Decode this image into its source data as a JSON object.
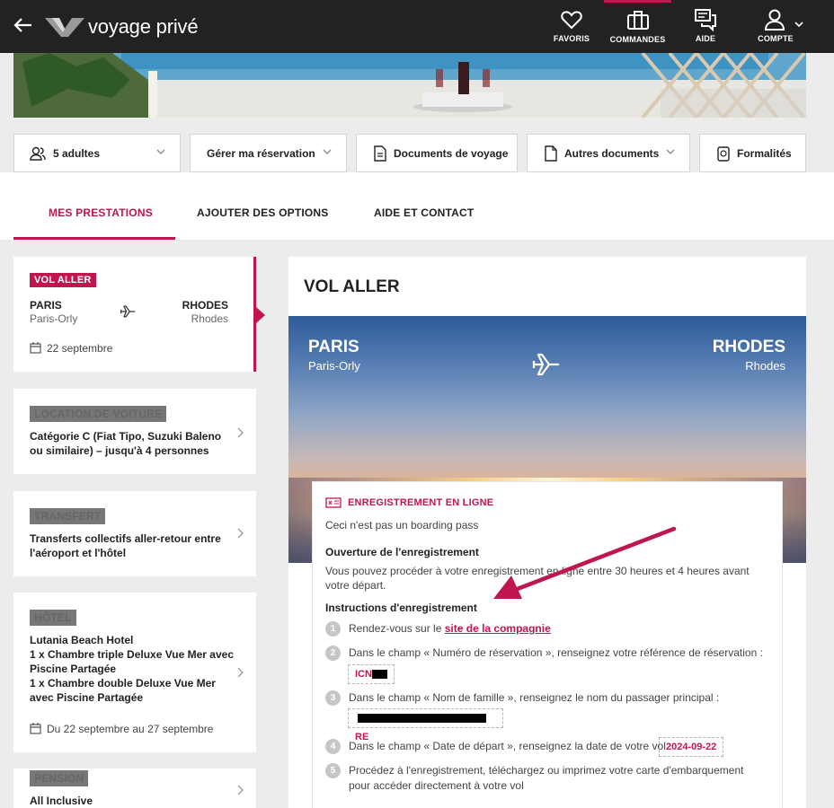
{
  "header": {
    "logo_text_a": "voyage",
    "logo_text_b": "privé",
    "nav": [
      {
        "label": "FAVORIS",
        "icon": "heart-icon"
      },
      {
        "label": "COMMANDES",
        "icon": "briefcase-icon",
        "active": true
      },
      {
        "label": "AIDE",
        "icon": "chat-icon"
      },
      {
        "label": "COMPTE",
        "icon": "user-icon"
      }
    ]
  },
  "reservation_bar": {
    "travelers": "5 adultes",
    "manage": "Gérer ma réservation",
    "travel_docs": "Documents de voyage",
    "other_docs": "Autres documents",
    "formalities": "Formalités"
  },
  "tabs": [
    {
      "label": "MES PRESTATIONS",
      "active": true
    },
    {
      "label": "AJOUTER DES OPTIONS"
    },
    {
      "label": "AIDE ET CONTACT"
    }
  ],
  "sidebar": {
    "flight": {
      "badge": "VOL ALLER",
      "from_city": "PARIS",
      "from_airport": "Paris-Orly",
      "to_city": "RHODES",
      "to_airport": "Rhodes",
      "date": "22 septembre"
    },
    "car": {
      "badge": "LOCATION DE VOITURE",
      "desc": "Catégorie C (Fiat Tipo, Suzuki Baleno ou similaire) – jusqu'à 4 personnes"
    },
    "transfer": {
      "badge": "TRANSFERT",
      "desc": "Transferts collectifs aller-retour entre l'aéroport et l'hôtel"
    },
    "hotel": {
      "badge": "HÔTEL",
      "name": "Lutania Beach Hotel",
      "room1": "1 x Chambre triple Deluxe Vue Mer avec Piscine Partagée",
      "room2": "1 x Chambre double Deluxe Vue Mer avec Piscine Partagée",
      "dates": "Du 22 septembre au 27 septembre"
    },
    "board": {
      "badge": "PENSION",
      "desc": "All Inclusive"
    }
  },
  "main": {
    "title": "VOL ALLER",
    "from_city": "PARIS",
    "from_airport": "Paris-Orly",
    "to_city": "RHODES",
    "to_airport": "Rhodes",
    "checkin": {
      "title": "ENREGISTREMENT EN LIGNE",
      "subtitle": "Ceci n'est pas un boarding pass",
      "opening_heading": "Ouverture de l'enregistrement",
      "opening_text": "Vous pouvez procéder à votre enregistrement en ligne entre 30 heures et 4 heures avant votre départ.",
      "instructions_heading": "Instructions d'enregistrement",
      "step1_text": "Rendez-vous sur le",
      "step1_link": "site de la compagnie",
      "step2_text": "Dans le champ « Numéro de réservation », renseignez votre référence de réservation :",
      "step2_value": "ICN",
      "step3_text": "Dans le champ « Nom de famille », renseignez le nom du passager principal :",
      "step3_value": "RE",
      "step4_text": "Dans le champ « Date de départ », renseignez la date de votre vol :",
      "step4_value": "2024-09-22",
      "step5_text": "Procédez à l'enregistrement, téléchargez ou imprimez votre carte d'embarquement pour accéder directement à votre vol",
      "nums": [
        "1",
        "2",
        "3",
        "4",
        "5"
      ]
    }
  },
  "colors": {
    "accent": "#c0154f",
    "topbar": "#222222"
  }
}
